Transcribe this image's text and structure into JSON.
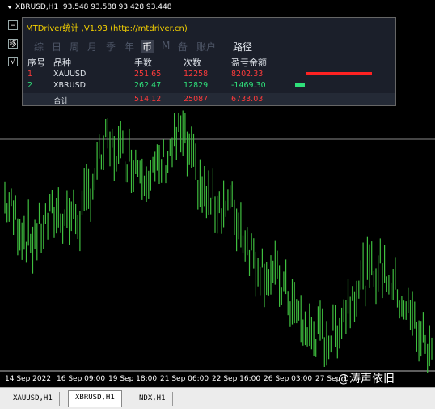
{
  "window": {
    "symbol": "XBRUSD,H1",
    "ohlc": "93.548 93.588 93.428 93.448"
  },
  "panel": {
    "title": "MTDriver统计 ,V1.93 (http://mtdriver.cn)",
    "periods": [
      "综",
      "日",
      "周",
      "月",
      "季",
      "年",
      "币",
      "M",
      "备",
      "账户"
    ],
    "active_period": "币",
    "route_label": "路径",
    "headers": {
      "index": "序号",
      "product": "品种",
      "lots": "手数",
      "count": "次数",
      "pnl": "盈亏金额"
    },
    "rows": [
      {
        "index": "1",
        "product": "XAUUSD",
        "lots": "251.65",
        "count": "12258",
        "pnl": "8202.33",
        "bar_ratio": 1.0,
        "color": "#ff2222"
      },
      {
        "index": "2",
        "product": "XBRUSD",
        "lots": "262.47",
        "count": "12829",
        "pnl": "-1469.30",
        "bar_ratio": 0.15,
        "color": "#2fe07a"
      }
    ],
    "total": {
      "label": "合计",
      "lots": "514.12",
      "count": "25087",
      "pnl": "6733.03"
    }
  },
  "buttons": {
    "minimize": "−",
    "move": "移",
    "check": "√"
  },
  "x_axis_labels": [
    "14 Sep 2022",
    "16 Sep 09:00",
    "19 Sep 18:00",
    "21 Sep 06:00",
    "22 Sep 16:00",
    "26 Sep 03:00",
    "27 Sep 1"
  ],
  "watermark": "@涛声依旧",
  "symbol_tabs": [
    "XAUUSD,H1",
    "XBRUSD,H1",
    "NDX,H1"
  ],
  "active_symbol_tab": "XBRUSD,H1",
  "colors": {
    "candle": "#3fbf3f",
    "grid_line": "#8a8a8a",
    "panel_bg": "#1b1f2a",
    "title": "#f4d000"
  },
  "chart_data": {
    "type": "line",
    "title": "",
    "xlabel": "",
    "ylabel": "",
    "x": [
      "14 Sep 2022",
      "16 Sep 09:00",
      "19 Sep 18:00",
      "21 Sep 06:00",
      "22 Sep 16:00",
      "26 Sep 03:00",
      "27 Sep 1"
    ],
    "series": [
      {
        "values": [
          94.2,
          93.5,
          94.0,
          93.9,
          95.1,
          94.9,
          94.6,
          95.3,
          94.2,
          94.1,
          93.2,
          92.8,
          92.0,
          91.9,
          92.8,
          93.1,
          92.4,
          91.6
        ]
      }
    ]
  }
}
